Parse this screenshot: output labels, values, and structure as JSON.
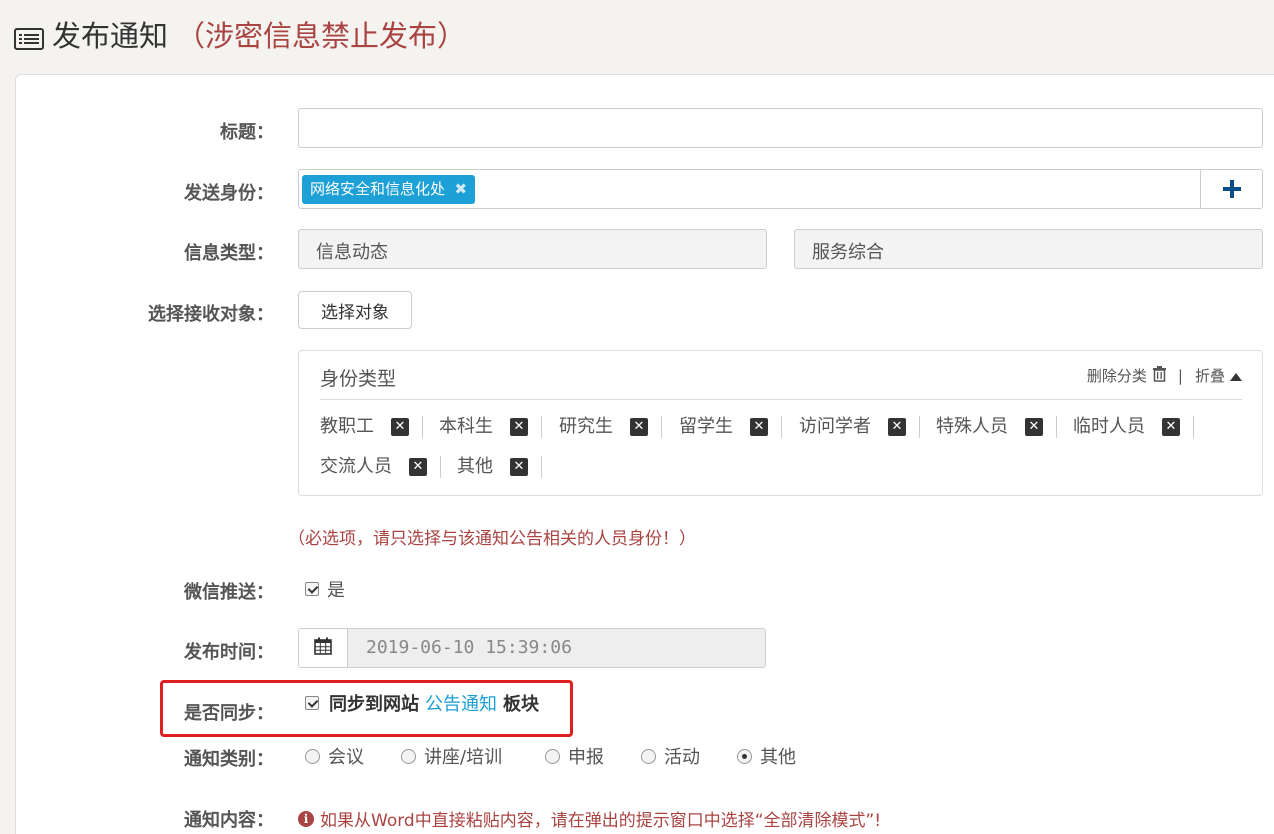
{
  "header": {
    "icon": "list-icon",
    "title": "发布通知",
    "warning": "（涉密信息禁止发布）"
  },
  "form": {
    "title_label": "标题：",
    "title_value": "",
    "sender_label": "发送身份：",
    "sender_tag": "网络安全和信息化处",
    "sender_add_icon": "plus-icon",
    "info_type_label": "信息类型：",
    "info_type_primary": "信息动态",
    "info_type_secondary": "服务综合",
    "recipients_label": "选择接收对象：",
    "select_button": "选择对象",
    "identity_box": {
      "title": "身份类型",
      "delete_label": "删除分类",
      "delete_icon": "trash-icon",
      "separator": "|",
      "collapse_label": "折叠",
      "collapse_icon": "caret-up-icon",
      "chips": [
        "教职工",
        "本科生",
        "研究生",
        "留学生",
        "访问学者",
        "特殊人员",
        "临时人员",
        "交流人员",
        "其他"
      ]
    },
    "required_hint": "（必选项，请只选择与该通知公告相关的人员身份！）",
    "wechat_label": "微信推送：",
    "wechat_option": "是",
    "wechat_checked": true,
    "publish_time_label": "发布时间：",
    "publish_time_icon": "calendar-icon",
    "publish_time_value": "2019-06-10 15:39:06",
    "sync_label": "是否同步：",
    "sync_checked": true,
    "sync_prefix": "同步到网站",
    "sync_link": "公告通知",
    "sync_suffix": "板块",
    "category_label": "通知类别：",
    "categories": [
      "会议",
      "讲座/培训",
      "申报",
      "活动",
      "其他"
    ],
    "category_selected": "其他",
    "content_label": "通知内容：",
    "content_hint": "如果从Word中直接粘贴内容，请在弹出的提示窗口中选择“全部清除模式”!",
    "content_hint_icon": "info-circle-icon"
  },
  "colors": {
    "warning": "#a94442",
    "tag_bg": "#1da0d6",
    "link": "#1a9fd8",
    "highlight_border": "#e02020",
    "plus": "#0b4e87"
  }
}
